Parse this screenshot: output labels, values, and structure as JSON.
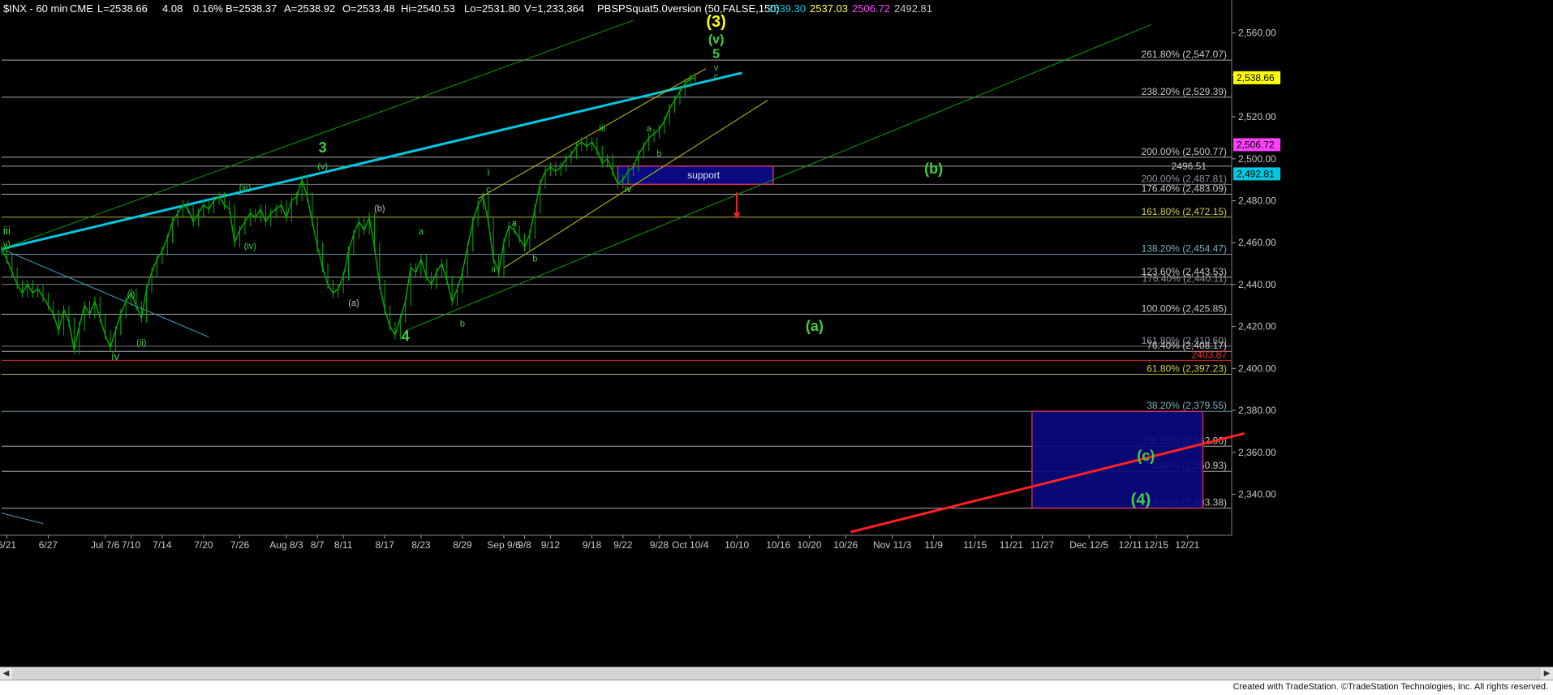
{
  "header": {
    "symbol": "$INX - 60 min",
    "exchange": "CME",
    "last": "L=2538.66",
    "change": "4.08",
    "pct": "0.16%",
    "bid": "B=2538.37",
    "ask": "A=2538.92",
    "open": "O=2533.48",
    "high": "Hi=2540.53",
    "low": "Lo=2531.80",
    "volume": "V=1,233,364",
    "indicator": "PBSPSquat5.0version (50,FALSE,150)",
    "ind_v1": "2539.30",
    "ind_v2": "2537.03",
    "ind_v3": "2506.72",
    "ind_v4": "2492.81"
  },
  "colors": {
    "background": "#000000",
    "price_bars": "#00b000",
    "white_text": "#ffffff",
    "cyan": "#00c8e0",
    "green_label": "#40d040",
    "yellow": "#ffff00",
    "red": "#ff2020",
    "magenta": "#ff40ff",
    "navy_box": "#0a0a80"
  },
  "chart_data": {
    "type": "line",
    "title": "",
    "xlabel": "",
    "ylabel": "",
    "ylim": [
      2322,
      2568
    ],
    "y_ticks": [
      "2,560.00",
      "2,540.00",
      "2,520.00",
      "2,500.00",
      "2,480.00",
      "2,460.00",
      "2,440.00",
      "2,420.00",
      "2,400.00",
      "2,380.00",
      "2,360.00",
      "2,340.00"
    ],
    "y_tick_values": [
      2560,
      2540,
      2520,
      2500,
      2480,
      2460,
      2440,
      2420,
      2400,
      2380,
      2360,
      2340
    ],
    "x_tick_labels": [
      "6/21",
      "6/27",
      "Jul 7/6",
      "7/10",
      "7/14",
      "7/20",
      "7/26",
      "Aug 8/3",
      "8/7",
      "8/11",
      "8/17",
      "8/23",
      "8/29",
      "Sep 9/6",
      "9/8",
      "9/12",
      "9/18",
      "9/22",
      "9/28",
      "Oct 10/4",
      "10/10",
      "10/16",
      "10/20",
      "10/26",
      "Nov 11/3",
      "11/9",
      "11/15",
      "11/21",
      "11/27",
      "Dec 12/5",
      "12/11",
      "12/15",
      "12/21"
    ],
    "x_tick_index": [
      1,
      9,
      20,
      25,
      31,
      39,
      46,
      55,
      61,
      66,
      74,
      81,
      89,
      97,
      101,
      106,
      114,
      120,
      127,
      133,
      142,
      150,
      156,
      163,
      172,
      180,
      188,
      195,
      201,
      210,
      218,
      223,
      229
    ],
    "x_tick_index_max": 236,
    "series": [
      {
        "values": [
          [
            0,
            2457
          ],
          [
            1,
            2452
          ],
          [
            2,
            2446
          ],
          [
            3,
            2440
          ],
          [
            4,
            2436
          ],
          [
            5,
            2440
          ],
          [
            6,
            2436
          ],
          [
            7,
            2438
          ],
          [
            8,
            2434
          ],
          [
            9,
            2430
          ],
          [
            10,
            2426
          ],
          [
            11,
            2418
          ],
          [
            12,
            2428
          ],
          [
            13,
            2422
          ],
          [
            14,
            2409
          ],
          [
            15,
            2420
          ],
          [
            16,
            2430
          ],
          [
            17,
            2426
          ],
          [
            18,
            2432
          ],
          [
            19,
            2424
          ],
          [
            20,
            2416
          ],
          [
            21,
            2410
          ],
          [
            22,
            2418
          ],
          [
            23,
            2426
          ],
          [
            24,
            2432
          ],
          [
            25,
            2436
          ],
          [
            26,
            2430
          ],
          [
            27,
            2424
          ],
          [
            28,
            2438
          ],
          [
            29,
            2446
          ],
          [
            30,
            2452
          ],
          [
            31,
            2456
          ],
          [
            32,
            2462
          ],
          [
            33,
            2470
          ],
          [
            34,
            2474
          ],
          [
            35,
            2478
          ],
          [
            36,
            2476
          ],
          [
            37,
            2470
          ],
          [
            38,
            2474
          ],
          [
            39,
            2478
          ],
          [
            40,
            2476
          ],
          [
            41,
            2480
          ],
          [
            42,
            2482
          ],
          [
            43,
            2478
          ],
          [
            44,
            2476
          ],
          [
            45,
            2460
          ],
          [
            46,
            2466
          ],
          [
            47,
            2470
          ],
          [
            48,
            2474
          ],
          [
            49,
            2472
          ],
          [
            50,
            2476
          ],
          [
            51,
            2470
          ],
          [
            52,
            2474
          ],
          [
            53,
            2476
          ],
          [
            54,
            2478
          ],
          [
            55,
            2472
          ],
          [
            56,
            2480
          ],
          [
            57,
            2482
          ],
          [
            58,
            2490
          ],
          [
            59,
            2482
          ],
          [
            60,
            2470
          ],
          [
            61,
            2458
          ],
          [
            62,
            2448
          ],
          [
            63,
            2440
          ],
          [
            64,
            2436
          ],
          [
            65,
            2438
          ],
          [
            66,
            2444
          ],
          [
            67,
            2456
          ],
          [
            68,
            2464
          ],
          [
            69,
            2470
          ],
          [
            70,
            2466
          ],
          [
            71,
            2472
          ],
          [
            72,
            2458
          ],
          [
            73,
            2440
          ],
          [
            74,
            2428
          ],
          [
            75,
            2420
          ],
          [
            76,
            2416
          ],
          [
            77,
            2424
          ],
          [
            78,
            2432
          ],
          [
            79,
            2448
          ],
          [
            80,
            2446
          ],
          [
            81,
            2452
          ],
          [
            82,
            2444
          ],
          [
            83,
            2440
          ],
          [
            84,
            2446
          ],
          [
            85,
            2450
          ],
          [
            86,
            2442
          ],
          [
            87,
            2432
          ],
          [
            88,
            2438
          ],
          [
            89,
            2446
          ],
          [
            90,
            2458
          ],
          [
            91,
            2470
          ],
          [
            92,
            2478
          ],
          [
            93,
            2482
          ],
          [
            94,
            2470
          ],
          [
            95,
            2452
          ],
          [
            96,
            2446
          ],
          [
            97,
            2460
          ],
          [
            98,
            2468
          ],
          [
            99,
            2466
          ],
          [
            100,
            2462
          ],
          [
            101,
            2458
          ],
          [
            102,
            2464
          ],
          [
            103,
            2476
          ],
          [
            104,
            2488
          ],
          [
            105,
            2494
          ],
          [
            106,
            2496
          ],
          [
            107,
            2494
          ],
          [
            108,
            2496
          ],
          [
            109,
            2500
          ],
          [
            110,
            2502
          ],
          [
            111,
            2506
          ],
          [
            112,
            2508
          ],
          [
            113,
            2506
          ],
          [
            114,
            2508
          ],
          [
            115,
            2504
          ],
          [
            116,
            2498
          ],
          [
            117,
            2500
          ],
          [
            118,
            2494
          ],
          [
            119,
            2488
          ],
          [
            120,
            2490
          ],
          [
            121,
            2494
          ],
          [
            122,
            2496
          ],
          [
            123,
            2502
          ],
          [
            124,
            2506
          ],
          [
            125,
            2510
          ],
          [
            126,
            2512
          ],
          [
            127,
            2514
          ],
          [
            128,
            2518
          ],
          [
            129,
            2524
          ],
          [
            130,
            2528
          ],
          [
            131,
            2532
          ],
          [
            132,
            2536
          ],
          [
            133,
            2538
          ],
          [
            134,
            2538.66
          ]
        ]
      }
    ],
    "horizontal_levels": [
      {
        "label": "261.80% (2,547.07)",
        "value": 2547.07,
        "color": "#c8c8c8"
      },
      {
        "label": "238.20% (2,529.39)",
        "value": 2529.39,
        "color": "#c8c8c8"
      },
      {
        "label": "200.00% (2,500.77)",
        "value": 2500.77,
        "color": "#c8c8c8"
      },
      {
        "label": "200.00% (2,487.81)",
        "value": 2487.81,
        "color": "#9090a0"
      },
      {
        "label": "176.40% (2,483.09)",
        "value": 2483.09,
        "color": "#c8c8c8"
      },
      {
        "label": "161.80% (2,472.15)",
        "value": 2472.15,
        "color": "#d0d050"
      },
      {
        "label": "138.20% (2,454.47)",
        "value": 2454.47,
        "color": "#7fb0c0"
      },
      {
        "label": "123.60% (2,443.53)",
        "value": 2443.53,
        "color": "#c8c8c8"
      },
      {
        "label": "176.40% (2,440.11)",
        "value": 2440.11,
        "color": "#9090a0"
      },
      {
        "label": "100.00% (2,425.85)",
        "value": 2425.85,
        "color": "#c8c8c8"
      },
      {
        "label": "161.80% (2,410.60)",
        "value": 2410.6,
        "color": "#9090a0"
      },
      {
        "label": "76.40% (2,408.17)",
        "value": 2408.17,
        "color": "#c8c8c8"
      },
      {
        "label": "2403.87",
        "value": 2403.87,
        "color": "#ff3030"
      },
      {
        "label": "61.80% (2,397.23)",
        "value": 2397.23,
        "color": "#d0d050"
      },
      {
        "label": "38.20% (2,379.55)",
        "value": 2379.55,
        "color": "#7fb0c0"
      },
      {
        "label": "138.20% (2,362.90)",
        "value": 2362.9,
        "color": "#c8c8c8"
      },
      {
        "label": "0.00% (2,350.93)",
        "value": 2350.93,
        "color": "#c8c8c8"
      },
      {
        "label": "123.60% (2,333.38)",
        "value": 2333.38,
        "color": "#c8c8c8"
      }
    ],
    "extra_level": {
      "label": "2496.51",
      "value": 2496.51
    },
    "price_tags": [
      {
        "label": "2,538.66",
        "value": 2538.66,
        "bg": "#ffff00",
        "fg": "#000000"
      },
      {
        "label": "2,506.72",
        "value": 2506.72,
        "bg": "#ff40ff",
        "fg": "#000000"
      },
      {
        "label": "2,492.81",
        "value": 2492.81,
        "bg": "#00c8e0",
        "fg": "#000000"
      }
    ],
    "support_box": {
      "label": "support",
      "x_from": 119,
      "x_to": 149,
      "y_from": 2487.81,
      "y_to": 2496.51
    },
    "target_box": {
      "x_from": 199,
      "x_to": 232,
      "y_from": 2333.38,
      "y_to": 2379.55
    },
    "trendlines": [
      {
        "color": "#00c8e0",
        "width": 3,
        "x1": 0,
        "y1": 2457,
        "x2": 143,
        "y2": 2541
      },
      {
        "color": "#00a000",
        "width": 1,
        "x1": 0,
        "y1": 2457,
        "x2": 122,
        "y2": 2566
      },
      {
        "color": "#00a000",
        "width": 1,
        "x1": 78,
        "y1": 2418,
        "x2": 222,
        "y2": 2564
      },
      {
        "color": "#c8c800",
        "width": 1,
        "x1": 97,
        "y1": 2448,
        "x2": 148,
        "y2": 2528
      },
      {
        "color": "#c8c800",
        "width": 1,
        "x1": 92,
        "y1": 2481,
        "x2": 136,
        "y2": 2543
      },
      {
        "color": "#3fa0c0",
        "width": 1,
        "x1": 0,
        "y1": 2457,
        "x2": 40,
        "y2": 2415
      },
      {
        "color": "#ff2020",
        "width": 3,
        "x1": 164,
        "y1": 2322,
        "x2": 240,
        "y2": 2369
      },
      {
        "color": "#3fa0c0",
        "width": 1,
        "x1": 0,
        "y1": 2331,
        "x2": 8,
        "y2": 2326
      }
    ],
    "wave_labels": [
      {
        "text": "iii",
        "x": 1,
        "y": 2464,
        "color": "#40d040",
        "size": 14
      },
      {
        "text": "v)",
        "x": 1,
        "y": 2458,
        "color": "#40d040",
        "size": 11
      },
      {
        "text": "iv",
        "x": 22,
        "y": 2404,
        "color": "#40d040",
        "size": 14
      },
      {
        "text": "(i)",
        "x": 25,
        "y": 2434,
        "color": "#40d040",
        "size": 11
      },
      {
        "text": "(ii)",
        "x": 27,
        "y": 2411,
        "color": "#40d040",
        "size": 11
      },
      {
        "text": "(iii)",
        "x": 47,
        "y": 2485,
        "color": "#40d040",
        "size": 11
      },
      {
        "text": "(iv)",
        "x": 48,
        "y": 2457,
        "color": "#40d040",
        "size": 11
      },
      {
        "text": "3",
        "x": 62,
        "y": 2503,
        "color": "#40d040",
        "size": 18
      },
      {
        "text": "(v)",
        "x": 62,
        "y": 2495,
        "color": "#40d040",
        "size": 11
      },
      {
        "text": "(a)",
        "x": 68,
        "y": 2430,
        "color": "#c8c8c8",
        "size": 11
      },
      {
        "text": "(b)",
        "x": 73,
        "y": 2475,
        "color": "#c8c8c8",
        "size": 11
      },
      {
        "text": "4",
        "x": 78,
        "y": 2413,
        "color": "#40d040",
        "size": 18
      },
      {
        "text": "a",
        "x": 81,
        "y": 2464,
        "color": "#40d040",
        "size": 11
      },
      {
        "text": "b",
        "x": 89,
        "y": 2420,
        "color": "#40d040",
        "size": 11
      },
      {
        "text": "i",
        "x": 94,
        "y": 2492,
        "color": "#40d040",
        "size": 12
      },
      {
        "text": "c",
        "x": 94,
        "y": 2484,
        "color": "#40d040",
        "size": 11
      },
      {
        "text": "ii",
        "x": 95,
        "y": 2446,
        "color": "#40d040",
        "size": 11
      },
      {
        "text": "a",
        "x": 99,
        "y": 2468,
        "color": "#40d040",
        "size": 11
      },
      {
        "text": "b",
        "x": 103,
        "y": 2451,
        "color": "#40d040",
        "size": 11
      },
      {
        "text": "iii",
        "x": 116,
        "y": 2513,
        "color": "#40d040",
        "size": 12
      },
      {
        "text": "iv",
        "x": 121,
        "y": 2484,
        "color": "#40d040",
        "size": 12
      },
      {
        "text": "a",
        "x": 125,
        "y": 2513,
        "color": "#40d040",
        "size": 11
      },
      {
        "text": "b",
        "x": 127,
        "y": 2501,
        "color": "#40d040",
        "size": 11
      },
      {
        "text": "(3)",
        "x": 138,
        "y": 2563,
        "color": "#ffff00",
        "size": 20
      },
      {
        "text": "(v)",
        "x": 138,
        "y": 2555,
        "color": "#40d040",
        "size": 16
      },
      {
        "text": "5",
        "x": 138,
        "y": 2548,
        "color": "#40d040",
        "size": 16
      },
      {
        "text": "v",
        "x": 138,
        "y": 2542,
        "color": "#40d040",
        "size": 11
      },
      {
        "text": "c",
        "x": 138,
        "y": 2538,
        "color": "#40d040",
        "size": 11
      },
      {
        "text": "(b)",
        "x": 180,
        "y": 2493,
        "color": "#40d040",
        "size": 18
      },
      {
        "text": "(a)",
        "x": 157,
        "y": 2418,
        "color": "#40d040",
        "size": 18
      },
      {
        "text": "(c)",
        "x": 221,
        "y": 2356,
        "color": "#40d040",
        "size": 18
      },
      {
        "text": "(4)",
        "x": 220,
        "y": 2335,
        "color": "#40d040",
        "size": 20
      }
    ],
    "red_arrow": {
      "x": 142,
      "y_from": 2484,
      "y_to": 2472
    },
    "grid": false,
    "legend": "none"
  },
  "footer": {
    "credit": "Created with TradeStation. ©TradeStation Technologies, Inc. All rights reserved."
  }
}
